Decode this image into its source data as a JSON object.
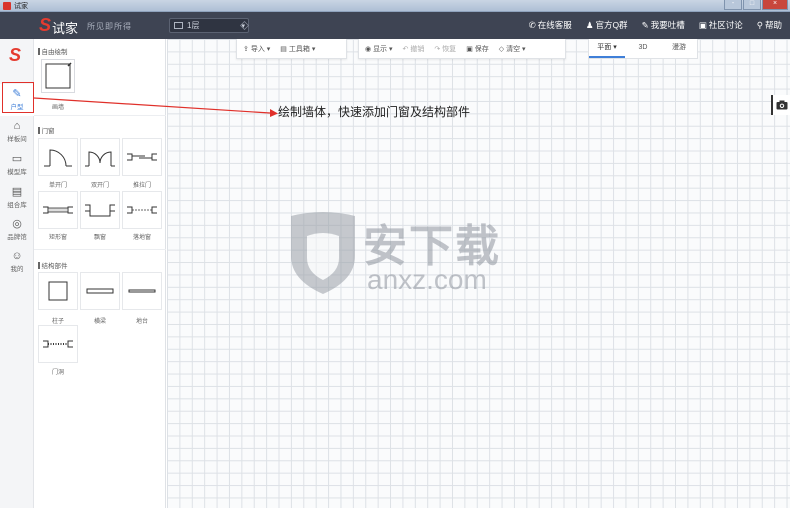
{
  "window": {
    "title": "试家",
    "min": "-",
    "max": "□",
    "close": "×"
  },
  "header": {
    "brand": "试家",
    "slogan": "所见即所得",
    "floor": "1层",
    "links": [
      {
        "icon": "phone-icon",
        "glyph": "✆",
        "label": "在线客服"
      },
      {
        "icon": "qq-icon",
        "glyph": "♟",
        "label": "官方Q群"
      },
      {
        "icon": "feedback-icon",
        "glyph": "✎",
        "label": "我要吐槽"
      },
      {
        "icon": "forum-icon",
        "glyph": "▣",
        "label": "社区讨论"
      },
      {
        "icon": "help-icon",
        "glyph": "⚲",
        "label": "帮助"
      }
    ]
  },
  "sidebar": {
    "items": [
      {
        "glyph": "✎",
        "label": "户型",
        "active": true
      },
      {
        "glyph": "⌂",
        "label": "样板间"
      },
      {
        "glyph": "▭",
        "label": "模型库"
      },
      {
        "glyph": "▤",
        "label": "组合库"
      },
      {
        "glyph": "◎",
        "label": "品牌馆"
      },
      {
        "glyph": "☺",
        "label": "我的"
      }
    ]
  },
  "panel": {
    "freehand_title": "自由绘制",
    "wall_label": "画墙",
    "doors_title": "门窗",
    "doors": [
      "单开门",
      "双开门",
      "推拉门",
      "矩形窗",
      "飘窗",
      "落地窗"
    ],
    "structure_title": "结构部件",
    "structure": [
      "柱子",
      "横梁",
      "地台",
      "门洞"
    ]
  },
  "toolbar": {
    "import": "导入",
    "toolbox": "工具箱",
    "display": "显示",
    "undo": "撤销",
    "redo": "恢复",
    "save": "保存",
    "clear": "清空"
  },
  "view_tabs": [
    "平面",
    "3D",
    "漫游"
  ],
  "annotation": "绘制墙体，快速添加门窗及结构部件",
  "watermark": {
    "text": "安下载",
    "url": "anxz.com"
  },
  "colors": {
    "header": "#3e4453",
    "brand_red": "#e53b2f",
    "accent": "#3f7fd8",
    "annotation_arrow": "#e0302a"
  }
}
